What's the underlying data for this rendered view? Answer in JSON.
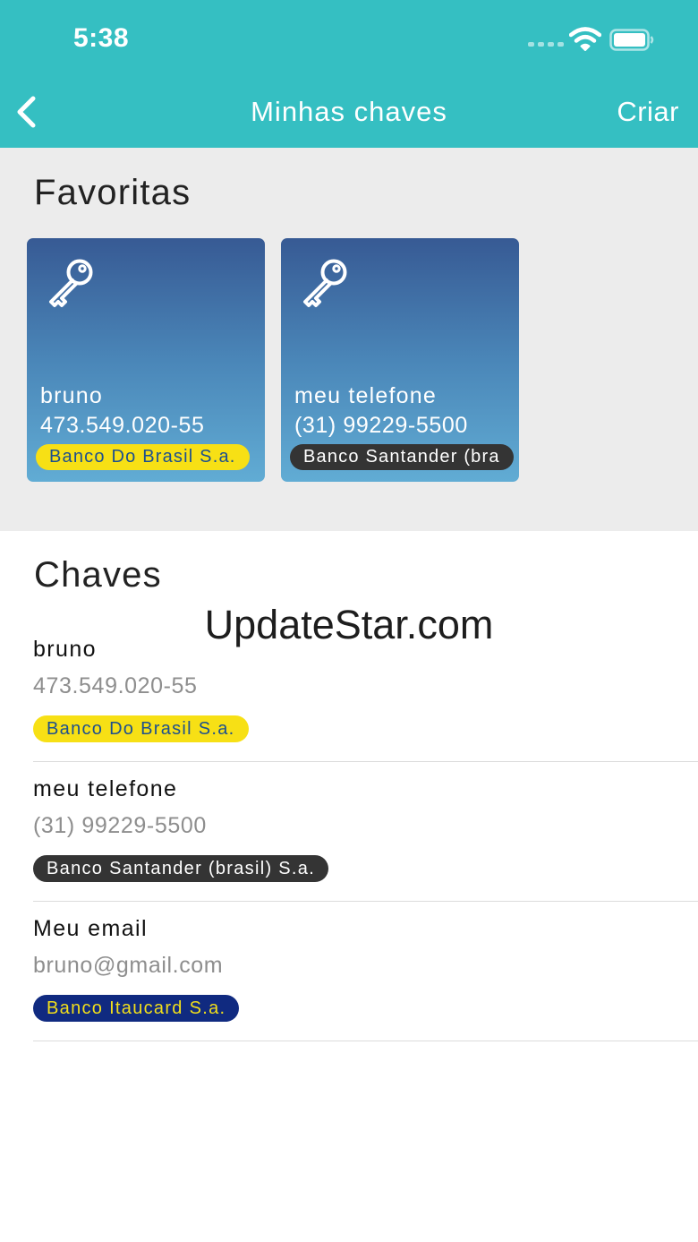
{
  "status_bar": {
    "time": "5:38",
    "icons": [
      "cellular-signal-icon",
      "wifi-icon",
      "battery-icon"
    ]
  },
  "nav": {
    "back_icon": "chevron-left-icon",
    "title": "Minhas chaves",
    "create_label": "Criar"
  },
  "favorites": {
    "title": "Favoritas",
    "cards": [
      {
        "icon": "key-icon",
        "name": "bruno",
        "value": "473.549.020-55",
        "bank": "Banco Do Brasil S.a."
      },
      {
        "icon": "key-icon",
        "name": "meu telefone",
        "value": "(31) 99229-5500",
        "bank": "Banco Santander (bra"
      }
    ]
  },
  "keys": {
    "title": "Chaves",
    "items": [
      {
        "name": "bruno",
        "value": "473.549.020-55",
        "bank": "Banco Do Brasil S.a."
      },
      {
        "name": "meu telefone",
        "value": "(31) 99229-5500",
        "bank": "Banco Santander (brasil) S.a."
      },
      {
        "name": "Meu email",
        "value": "bruno@gmail.com",
        "bank": "Banco Itaucard S.a."
      }
    ]
  },
  "watermark": "UpdateStar.com",
  "colors": {
    "header": "#35bfc2",
    "favorites_bg": "#ececec",
    "card_gradient_top": "#375a94",
    "card_gradient_bottom": "#61acd4",
    "chip_banco_do_brasil_bg": "#f7e015",
    "chip_banco_do_brasil_text": "#1c4f8f",
    "chip_santander_bg": "#343434",
    "chip_santander_text": "#ffffff",
    "chip_itaucard_bg": "#102a80",
    "chip_itaucard_text": "#f2df1a"
  }
}
